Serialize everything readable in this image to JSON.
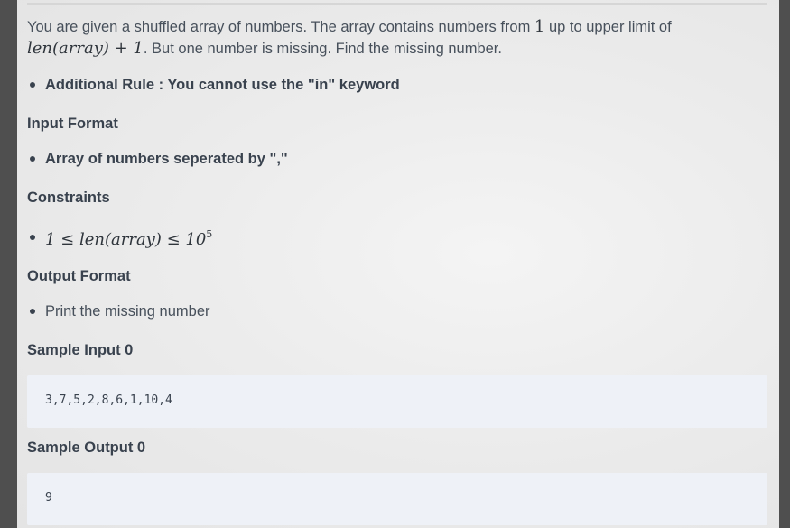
{
  "problem": {
    "intro_part1": "You are given a shuffled array of numbers. The array contains numbers from ",
    "intro_math_one": "1",
    "intro_part2": " up to upper limit of",
    "intro_math_len": "len(array) + 1",
    "intro_part3": ". But one number is missing. Find the missing number.",
    "additional_rule": "Additional Rule : You cannot use the \"in\" keyword"
  },
  "input_format": {
    "heading": "Input Format",
    "item": "Array of numbers seperated by \",\""
  },
  "constraints": {
    "heading": "Constraints",
    "lhs": "1 ≤ len(array) ≤ 10",
    "exponent": "5"
  },
  "output_format": {
    "heading": "Output Format",
    "item": "Print the missing number"
  },
  "sample_input": {
    "heading": "Sample Input 0",
    "code": "3,7,5,2,8,6,1,10,4"
  },
  "sample_output": {
    "heading": "Sample Output 0",
    "code": "9"
  }
}
